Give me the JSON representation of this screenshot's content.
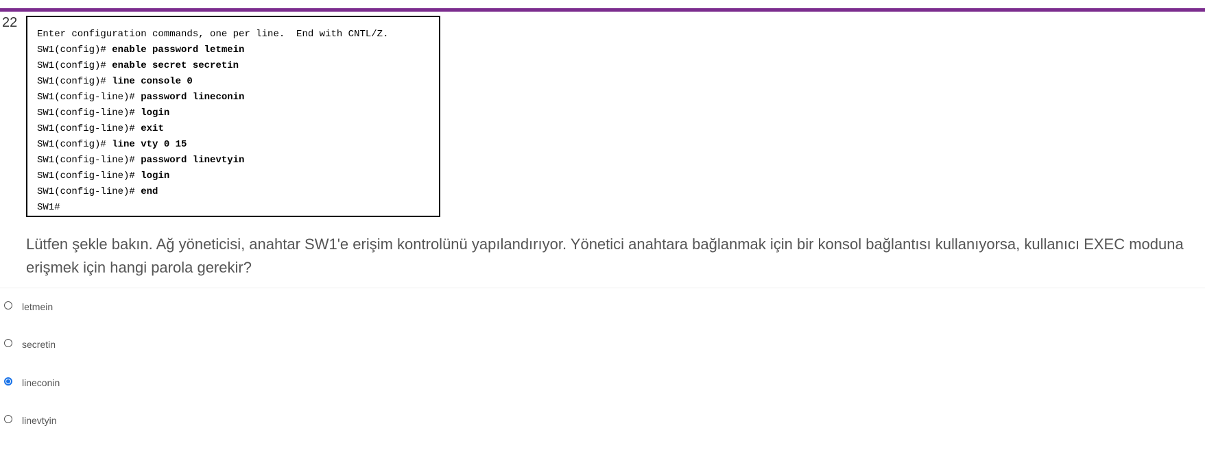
{
  "question": {
    "number": "22",
    "cli_lines": [
      {
        "prompt": "Enter configuration commands, one per line.  End with CNTL/Z.",
        "command": ""
      },
      {
        "prompt": "SW1(config)# ",
        "command": "enable password letmein"
      },
      {
        "prompt": "SW1(config)# ",
        "command": "enable secret secretin"
      },
      {
        "prompt": "SW1(config)# ",
        "command": "line console 0"
      },
      {
        "prompt": "SW1(config-line)# ",
        "command": "password lineconin"
      },
      {
        "prompt": "SW1(config-line)# ",
        "command": "login"
      },
      {
        "prompt": "SW1(config-line)# ",
        "command": "exit"
      },
      {
        "prompt": "SW1(config)# ",
        "command": "line vty 0 15"
      },
      {
        "prompt": "SW1(config-line)# ",
        "command": "password linevtyin"
      },
      {
        "prompt": "SW1(config-line)# ",
        "command": "login"
      },
      {
        "prompt": "SW1(config-line)# ",
        "command": "end"
      },
      {
        "prompt": "SW1#",
        "command": ""
      }
    ],
    "text": "Lütfen şekle bakın. Ağ yöneticisi, anahtar SW1'e erişim kontrolünü yapılandırıyor. Yönetici anahtara bağlanmak için bir konsol bağlantısı kullanıyorsa, kullanıcı EXEC moduna erişmek için hangi parola gerekir?"
  },
  "options": [
    {
      "label": "letmein",
      "selected": false
    },
    {
      "label": "secretin",
      "selected": false
    },
    {
      "label": "lineconin",
      "selected": true
    },
    {
      "label": "linevtyin",
      "selected": false
    }
  ],
  "colors": {
    "top_bar": "#7b2c8e",
    "radio_selected": "#1a73e8"
  }
}
